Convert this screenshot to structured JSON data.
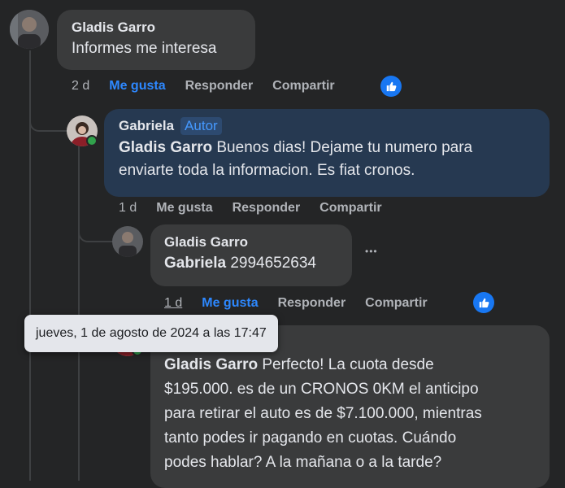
{
  "comments": [
    {
      "author": "Gladis Garro",
      "text": "Informes me interesa",
      "time": "2 d",
      "like_label": "Me gusta",
      "reply_label": "Responder",
      "share_label": "Compartir"
    },
    {
      "author": "Gabriela",
      "badge": "Autor",
      "mention": "Gladis Garro",
      "text_line1": " Buenos dias! Dejame tu numero para",
      "text_line2": "enviarte toda la informacion. Es fiat cronos.",
      "time": "1 d",
      "like_label": "Me gusta",
      "reply_label": "Responder",
      "share_label": "Compartir"
    },
    {
      "author": "Gladis Garro",
      "mention": "Gabriela",
      "text": " 2994652634",
      "more_icon": "•••",
      "time": "1 d",
      "like_label": "Me gusta",
      "reply_label": "Responder",
      "share_label": "Compartir"
    },
    {
      "author": "Gabriela",
      "mention": "Gladis Garro",
      "text_line1": " Perfecto! La cuota desde",
      "text_line2": "$195.000. es de un CRONOS 0KM el anticipo",
      "text_line3": "para retirar el auto es de $7.100.000, mientras",
      "text_line4": "tanto podes ir pagando en cuotas. Cuándo",
      "text_line5": "podes hablar? A la mañana o a la tarde?"
    }
  ],
  "tooltip": "jueves, 1 de agosto de 2024 a las 17:47",
  "colors": {
    "background": "#242526",
    "bubble": "#3a3b3c",
    "author_bubble": "#263951",
    "like_blue": "#2d88ff"
  },
  "icons": [
    "thumbs-up-icon",
    "more-options-icon"
  ]
}
